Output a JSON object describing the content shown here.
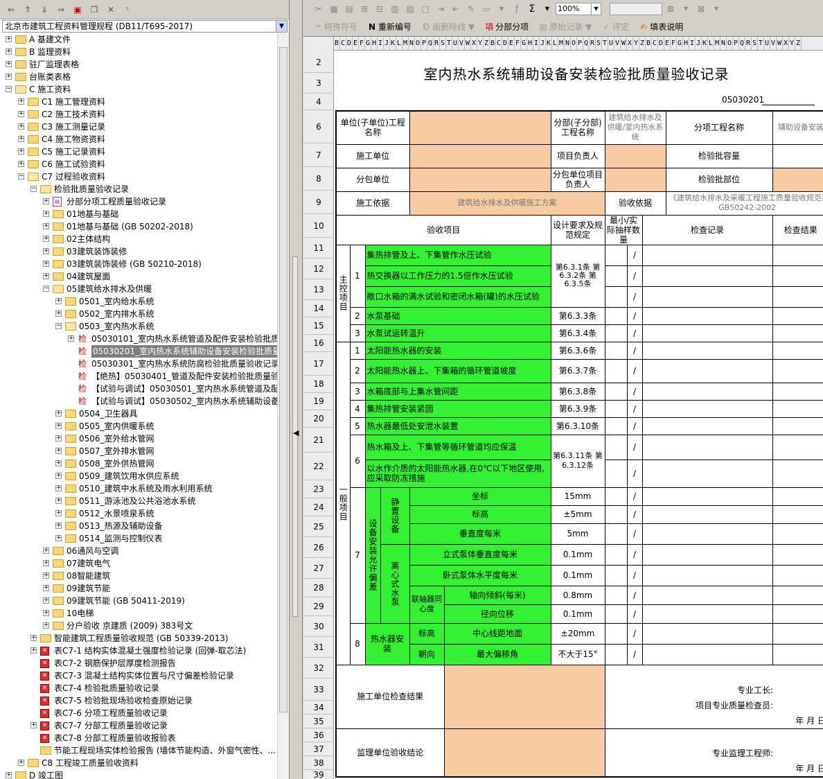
{
  "left_panel": {
    "rule_select": "北京市建筑工程资料管理规程 (DB11/T695-2017)",
    "tree": [
      {
        "level": 0,
        "exp": "+",
        "icon": "folder",
        "label": "A 基建文件"
      },
      {
        "level": 0,
        "exp": "+",
        "icon": "folder",
        "label": "B 监理资料"
      },
      {
        "level": 0,
        "exp": "+",
        "icon": "folder",
        "label": "驻厂监理表格"
      },
      {
        "level": 0,
        "exp": "+",
        "icon": "folder",
        "label": "台账类表格"
      },
      {
        "level": 0,
        "exp": "-",
        "icon": "folder-open",
        "label": "C 施工资料"
      },
      {
        "level": 1,
        "exp": "+",
        "icon": "folder",
        "label": "C1 施工管理资料"
      },
      {
        "level": 1,
        "exp": "+",
        "icon": "folder",
        "label": "C2 施工技术资料"
      },
      {
        "level": 1,
        "exp": "+",
        "icon": "folder",
        "label": "C3 施工测量记录"
      },
      {
        "level": 1,
        "exp": "+",
        "icon": "folder",
        "label": "C4 施工物资资料"
      },
      {
        "level": 1,
        "exp": "+",
        "icon": "folder",
        "label": "C5 施工记录资料"
      },
      {
        "level": 1,
        "exp": "+",
        "icon": "folder",
        "label": "C6 施工试验资料"
      },
      {
        "level": 1,
        "exp": "-",
        "icon": "folder-open",
        "label": "C7 过程验收资料"
      },
      {
        "level": 2,
        "exp": "-",
        "icon": "folder-open",
        "label": "检验批质量验收记录"
      },
      {
        "level": 3,
        "exp": "+",
        "icon": "doc",
        "label": "分部分项工程质量验收记录"
      },
      {
        "level": 3,
        "exp": "+",
        "icon": "folder",
        "label": "01地基与基础"
      },
      {
        "level": 3,
        "exp": "+",
        "icon": "folder",
        "label": "01地基与基础 (GB 50202-2018)"
      },
      {
        "level": 3,
        "exp": "+",
        "icon": "folder",
        "label": "02主体结构"
      },
      {
        "level": 3,
        "exp": "+",
        "icon": "folder",
        "label": "03建筑装饰装修"
      },
      {
        "level": 3,
        "exp": "+",
        "icon": "folder",
        "label": "03建筑装饰装修 (GB 50210-2018)"
      },
      {
        "level": 3,
        "exp": "+",
        "icon": "folder",
        "label": "04建筑屋面"
      },
      {
        "level": 3,
        "exp": "-",
        "icon": "folder-open",
        "label": "05建筑给水排水及供暖"
      },
      {
        "level": 4,
        "exp": "+",
        "icon": "folder",
        "label": "0501_室内给水系统"
      },
      {
        "level": 4,
        "exp": "+",
        "icon": "folder",
        "label": "0502_室内排水系统"
      },
      {
        "level": 4,
        "exp": "-",
        "icon": "folder-open",
        "label": "0503_室内热水系统"
      },
      {
        "level": 5,
        "exp": "+",
        "icon": "jian",
        "label": "05030101_室内热水系统管道及配件安装检验批质"
      },
      {
        "level": 5,
        "exp": "",
        "icon": "jian",
        "label": "05030201_室内热水系统辅助设备安装检验批质量",
        "selected": true
      },
      {
        "level": 5,
        "exp": "",
        "icon": "jian",
        "label": "05030301_室内热水系统防腐检验批质量验收记录"
      },
      {
        "level": 5,
        "exp": "",
        "icon": "jian",
        "label": "【绝热】05030401_管道及配件安装检验批质量验"
      },
      {
        "level": 5,
        "exp": "",
        "icon": "jian",
        "label": "【试验与调试】05030501_室内热水系统管道及配"
      },
      {
        "level": 5,
        "exp": "",
        "icon": "jian",
        "label": "【试验与调试】05030502_室内热水系统辅助设备"
      },
      {
        "level": 4,
        "exp": "+",
        "icon": "folder",
        "label": "0504_卫生器具"
      },
      {
        "level": 4,
        "exp": "+",
        "icon": "folder",
        "label": "0505_室内供暖系统"
      },
      {
        "level": 4,
        "exp": "+",
        "icon": "folder",
        "label": "0506_室外给水管网"
      },
      {
        "level": 4,
        "exp": "+",
        "icon": "folder",
        "label": "0507_室外排水管网"
      },
      {
        "level": 4,
        "exp": "+",
        "icon": "folder",
        "label": "0508_室外供热管网"
      },
      {
        "level": 4,
        "exp": "+",
        "icon": "folder",
        "label": "0509_建筑饮用水供应系统"
      },
      {
        "level": 4,
        "exp": "+",
        "icon": "folder",
        "label": "0510_建筑中水系统及雨水利用系统"
      },
      {
        "level": 4,
        "exp": "+",
        "icon": "folder",
        "label": "0511_游泳池及公共浴池水系统"
      },
      {
        "level": 4,
        "exp": "+",
        "icon": "folder",
        "label": "0512_水景喷泉系统"
      },
      {
        "level": 4,
        "exp": "+",
        "icon": "folder",
        "label": "0513_热源及辅助设备"
      },
      {
        "level": 4,
        "exp": "+",
        "icon": "folder",
        "label": "0514_监测与控制仪表"
      },
      {
        "level": 3,
        "exp": "+",
        "icon": "folder",
        "label": "06通风与空调"
      },
      {
        "level": 3,
        "exp": "+",
        "icon": "folder",
        "label": "07建筑电气"
      },
      {
        "level": 3,
        "exp": "+",
        "icon": "folder",
        "label": "08智能建筑"
      },
      {
        "level": 3,
        "exp": "+",
        "icon": "folder",
        "label": "09建筑节能"
      },
      {
        "level": 3,
        "exp": "+",
        "icon": "folder",
        "label": "09建筑节能 (GB 50411-2019)"
      },
      {
        "level": 3,
        "exp": "+",
        "icon": "folder",
        "label": "10电梯"
      },
      {
        "level": 3,
        "exp": "+",
        "icon": "folder",
        "label": "分户验收 京建质 (2009) 383号文"
      },
      {
        "level": 2,
        "exp": "+",
        "icon": "folder",
        "label": "智能建筑工程质量验收规范 (GB 50339-2013)"
      },
      {
        "level": 2,
        "exp": "+",
        "icon": "redx",
        "label": "表C7-1 结构实体混凝土强度检验记录 (回弹-取芯法)"
      },
      {
        "level": 2,
        "exp": "",
        "icon": "redx",
        "label": "表C7-2 钢筋保护层厚度检测报告"
      },
      {
        "level": 2,
        "exp": "",
        "icon": "redx",
        "label": "表C7-3 混凝土结构实体位置与尺寸偏差检验记录"
      },
      {
        "level": 2,
        "exp": "",
        "icon": "redx",
        "label": "表C7-4 检验批质量验收记录"
      },
      {
        "level": 2,
        "exp": "",
        "icon": "redx",
        "label": "表C7-5 检验批现场验收检查原始记录"
      },
      {
        "level": 2,
        "exp": "",
        "icon": "redx",
        "label": "表C7-6 分项工程质量验收记录"
      },
      {
        "level": 2,
        "exp": "+",
        "icon": "redx",
        "label": "表C7-7 分部工程质量验收记录"
      },
      {
        "level": 2,
        "exp": "",
        "icon": "redx",
        "label": "表C7-8 分部工程质量验收报验表"
      },
      {
        "level": 2,
        "exp": "",
        "icon": "folder",
        "label": "节能工程现场实体检验报告 (墙体节能构造、外窗气密性、..."
      },
      {
        "level": 1,
        "exp": "+",
        "icon": "folder",
        "label": "C8 工程竣工质量验收资料"
      },
      {
        "level": 0,
        "exp": "+",
        "icon": "folder",
        "label": "D 竣工图"
      }
    ]
  },
  "toolbar": {
    "zoom": "100%",
    "sigma": "Σ",
    "special_symbol": "特殊符号",
    "renumber": "重新编号",
    "delete_line": "画删除线",
    "sub_item": "分部分项",
    "original_record": "原始记录",
    "evaluate": "评定",
    "fill_guide": "填表说明"
  },
  "sheet": {
    "col_letters": "BCDEFGHIJKLMNOPQRSTUVWXYZ",
    "row_numbers": [
      "2",
      "3",
      "4",
      "6",
      "7",
      "8",
      "9",
      "10",
      "11",
      "12",
      "13",
      "14",
      "15",
      "16",
      "17",
      "18",
      "19",
      "20",
      "21",
      "22",
      "23",
      "24",
      "25",
      "26",
      "27",
      "28",
      "29",
      "30",
      "31",
      "32",
      "33",
      "34",
      "35",
      "36",
      "37",
      "38",
      "39"
    ],
    "title": "室内热水系统辅助设备安装检验批质量验收记录",
    "code": "05030201",
    "header": {
      "unit_name_label": "单位(子单位)工程名称",
      "sub_division_label": "分部(子分部)工程名称",
      "sub_division_value": "建筑给水排水及供暖/室内热水系统",
      "item_name_label": "分项工程名称",
      "item_name_value": "辅助设备安装",
      "construction_unit_label": "施工单位",
      "project_manager_label": "项目负责人",
      "batch_capacity_label": "检验批容量",
      "sub_contractor_label": "分包单位",
      "sub_manager_label": "分包单位项目负责人",
      "batch_location_label": "检验批部位",
      "basis_label": "施工依据",
      "basis_value": "建筑给水排水及供暖施工方案",
      "acceptance_basis_label": "验收依据",
      "acceptance_basis_value": "《建筑给水排水及采暖工程施工质量验收规范》GB50242-2002"
    },
    "columns": {
      "item": "验收项目",
      "design": "设计要求及规范规定",
      "min_sample": "最小/实际抽样数量",
      "record": "检查记录",
      "result": "检查结果"
    },
    "main_label": "主控项目",
    "general_label": "一般项目",
    "slash": "/",
    "main_items": [
      {
        "no": "1",
        "text": "集热排管及上、下集管作水压试验"
      },
      {
        "no": "",
        "text": "热交换器以工作压力的1.5倍作水压试验"
      },
      {
        "no": "",
        "text": "敞口水箱的满水试验和密闭水箱(罐)的水压试验"
      },
      {
        "no": "2",
        "text": "水泵基础",
        "clause": "第6.3.3条"
      },
      {
        "no": "3",
        "text": "水泵试运转温升",
        "clause": "第6.3.4条"
      }
    ],
    "main_item1_clause": "第6.3.1条 第6.3.2条 第6.3.5条",
    "general_items": [
      {
        "no": "1",
        "text": "太阳能热水器的安装",
        "clause": "第6.3.6条"
      },
      {
        "no": "2",
        "text": "太阳能热水器上、下集箱的循环管道坡度",
        "clause": "第6.3.7条"
      },
      {
        "no": "3",
        "text": "水箱底部与上集水管间距",
        "clause": "第6.3.8条"
      },
      {
        "no": "4",
        "text": "集热排管安装紧固",
        "clause": "第6.3.9条"
      },
      {
        "no": "5",
        "text": "热水器最低处安泄水装置",
        "clause": "第6.3.10条"
      }
    ],
    "g6": {
      "no": "6",
      "text_a": "热水箱及上、下集管等循环管道均应保温",
      "text_b": "以水作介质的太阳能热水器,在0℃以下地区使用,应采取防冻措施",
      "clause": "第6.3.11条 第6.3.12条"
    },
    "g7": {
      "no": "7",
      "group_label": "设备安装允许偏差",
      "static_label": "静置设备",
      "pump_label": "离心式水泵",
      "coupling_label": "联轴器同心度",
      "rows": [
        {
          "name": "坐标",
          "value": "15mm"
        },
        {
          "name": "标高",
          "value": "±5mm"
        },
        {
          "name": "垂直度每米",
          "value": "5mm"
        },
        {
          "name": "立式泵体垂直度每米",
          "value": "0.1mm"
        },
        {
          "name": "卧式泵体水平度每米",
          "value": "0.1mm"
        },
        {
          "name": "轴向倾斜(每米)",
          "value": "0.8mm"
        },
        {
          "name": "径向位移",
          "value": "0.1mm"
        }
      ]
    },
    "g8": {
      "no": "8",
      "label": "热水器安装",
      "r1_a": "标高",
      "r1_b": "中心线距地面",
      "r1_v": "±20mm",
      "r2_a": "朝向",
      "r2_b": "最大偏移角",
      "r2_v": "不大于15°"
    },
    "footer": {
      "construction_result_label": "施工单位检查结果",
      "foreman_label": "专业工长:",
      "inspector_label": "项目专业质量检查员:",
      "date": "年  月  日",
      "supervision_label": "监理单位验收结论",
      "supervisor_label": "专业监理工程师:"
    }
  }
}
